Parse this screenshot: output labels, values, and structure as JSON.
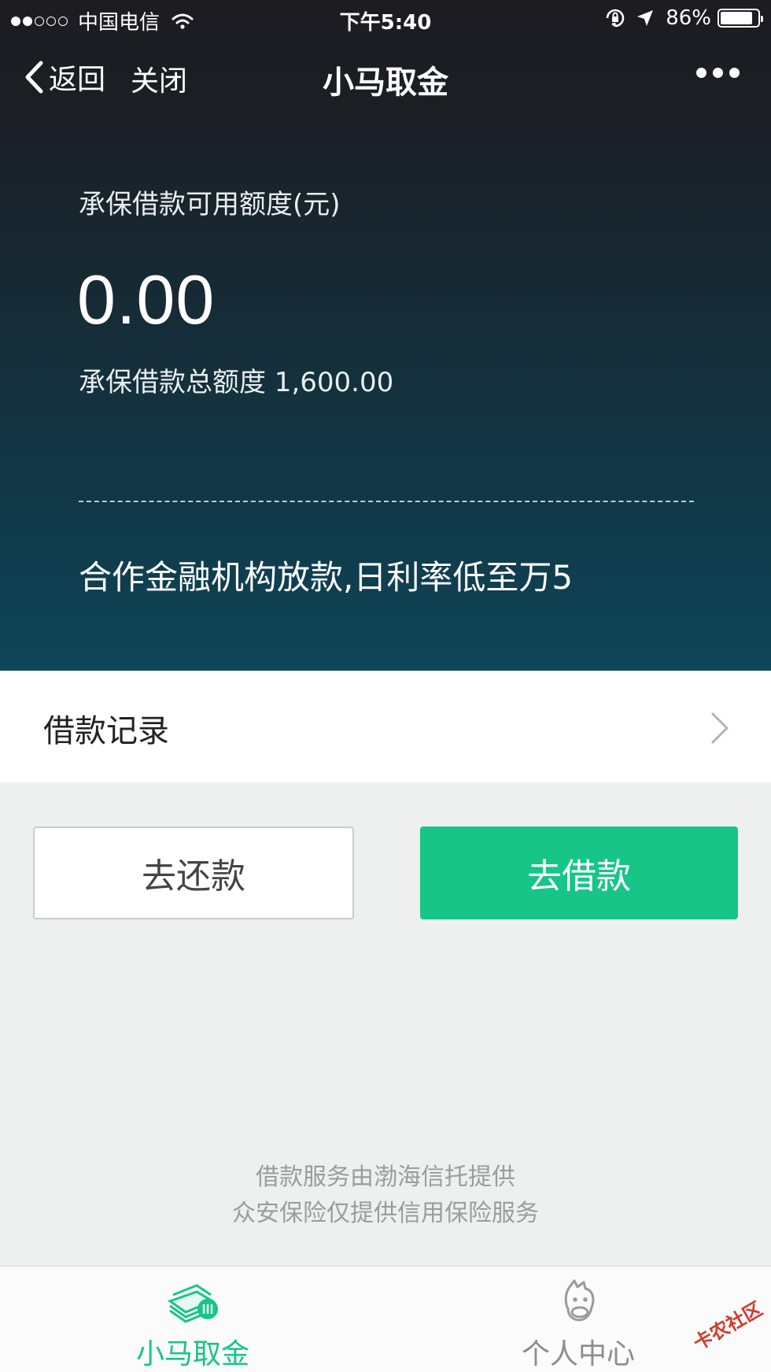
{
  "status_bar": {
    "carrier": "中国电信",
    "time": "下午5:40",
    "battery_percent": "86%",
    "battery_level": 0.86,
    "signal_bars_filled": 2,
    "signal_bars_total": 5,
    "icons": [
      "wifi-icon",
      "orientation-lock-icon",
      "location-arrow-icon",
      "battery-icon"
    ]
  },
  "nav": {
    "back_label": "返回",
    "close_label": "关闭",
    "title": "小马取金",
    "icons": [
      "chevron-left-icon",
      "more-dots-icon"
    ]
  },
  "quota": {
    "label": "承保借款可用额度(元)",
    "value": "0.00",
    "total_text": "承保借款总额度 1,600.00"
  },
  "promo": "合作金融机构放款,日利率低至万5",
  "records": {
    "label": "借款记录",
    "icon": "chevron-right-icon"
  },
  "actions": {
    "repay_label": "去还款",
    "borrow_label": "去借款"
  },
  "footer_note": {
    "line1": "借款服务由渤海信托提供",
    "line2": "众安保险仅提供信用保险服务"
  },
  "tabs": [
    {
      "label": "小马取金",
      "icon": "money-stack-icon",
      "active": true
    },
    {
      "label": "个人中心",
      "icon": "pony-avatar-icon",
      "active": false
    }
  ],
  "watermark": "卡农社区",
  "colors": {
    "accent_green": "#17c587",
    "header_dark": "#1c1c21",
    "header_teal": "#0d4559",
    "page_bg": "#eef0ef"
  }
}
